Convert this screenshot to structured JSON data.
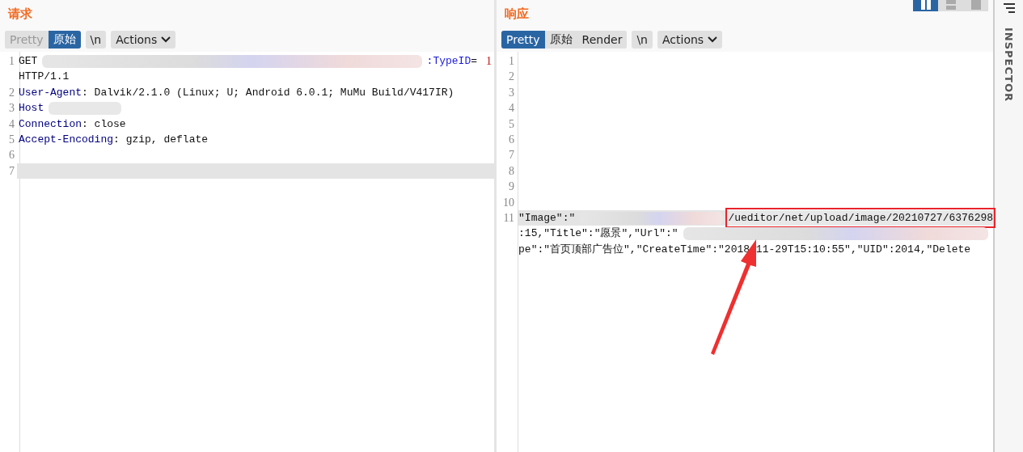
{
  "request": {
    "title": "请求",
    "tabs": [
      {
        "label": "Pretty",
        "selected": false,
        "disabled": true
      },
      {
        "label": "原始",
        "selected": true,
        "disabled": false
      }
    ],
    "buttons": [
      {
        "label": "\\n",
        "caret": false
      },
      {
        "label": "Actions",
        "caret": true
      }
    ],
    "lines": [
      {
        "number": "1",
        "highlighted": false,
        "rows": [
          [
            {
              "kind": "plain",
              "text": "GET"
            },
            {
              "kind": "blur"
            },
            {
              "kind": "param",
              "text": ":TypeID"
            },
            {
              "kind": "plain",
              "text": "="
            },
            {
              "kind": "num",
              "text": "1"
            }
          ],
          [
            {
              "kind": "plain",
              "text": "HTTP/1.1"
            }
          ]
        ]
      },
      {
        "number": "2",
        "highlighted": false,
        "rows": [
          [
            {
              "kind": "key",
              "text": "User-Agent"
            },
            {
              "kind": "plain",
              "text": ": Dalvik/2.1.0 (Linux; U; Android 6.0.1; MuMu Build/V417IR)"
            }
          ]
        ]
      },
      {
        "number": "3",
        "highlighted": false,
        "rows": [
          [
            {
              "kind": "key",
              "text": "Host"
            },
            {
              "kind": "blur-short"
            }
          ]
        ]
      },
      {
        "number": "4",
        "highlighted": false,
        "rows": [
          [
            {
              "kind": "key",
              "text": "Connection"
            },
            {
              "kind": "plain",
              "text": ": close"
            }
          ]
        ]
      },
      {
        "number": "5",
        "highlighted": false,
        "rows": [
          [
            {
              "kind": "key",
              "text": "Accept-Encoding"
            },
            {
              "kind": "plain",
              "text": ": gzip, deflate"
            }
          ]
        ]
      },
      {
        "number": "6",
        "highlighted": false,
        "rows": [
          []
        ]
      },
      {
        "number": "7",
        "highlighted": true,
        "rows": [
          []
        ]
      }
    ]
  },
  "response": {
    "title": "响应",
    "tabs": [
      {
        "label": "Pretty",
        "selected": true,
        "disabled": false
      },
      {
        "label": "原始",
        "selected": false,
        "disabled": false
      },
      {
        "label": "Render",
        "selected": false,
        "disabled": false
      }
    ],
    "buttons": [
      {
        "label": "\\n",
        "caret": false
      },
      {
        "label": "Actions",
        "caret": true
      }
    ],
    "lines": [
      {
        "number": "1",
        "highlighted": false,
        "rows": [
          []
        ]
      },
      {
        "number": "2",
        "highlighted": false,
        "rows": [
          []
        ]
      },
      {
        "number": "3",
        "highlighted": false,
        "rows": [
          []
        ]
      },
      {
        "number": "4",
        "highlighted": false,
        "rows": [
          []
        ]
      },
      {
        "number": "5",
        "highlighted": false,
        "rows": [
          []
        ]
      },
      {
        "number": "6",
        "highlighted": false,
        "rows": [
          []
        ]
      },
      {
        "number": "7",
        "highlighted": false,
        "rows": [
          []
        ]
      },
      {
        "number": "8",
        "highlighted": false,
        "rows": [
          []
        ]
      },
      {
        "number": "9",
        "highlighted": false,
        "rows": [
          []
        ]
      },
      {
        "number": "10",
        "highlighted": false,
        "rows": [
          []
        ]
      },
      {
        "number": "11",
        "highlighted": true,
        "rows": [
          [
            {
              "kind": "plain",
              "text": "\"Image\":\""
            },
            {
              "kind": "blur"
            },
            {
              "kind": "boxed",
              "text": "/ueditor/net/upload/image/20210727/6376298"
            }
          ],
          [
            {
              "kind": "plain",
              "text": ":15,\"Title\":\"愿景\",\"Url\":\""
            },
            {
              "kind": "blur"
            }
          ],
          [
            {
              "kind": "plain",
              "text": "pe\":\"首页顶部广告位\",\"CreateTime\":\"2018-11-29T15:10:55\",\"UID\":2014,\"Delete"
            }
          ]
        ]
      }
    ]
  },
  "layout_toggles": [
    {
      "selected": true
    },
    {
      "selected": false
    },
    {
      "selected": false
    }
  ],
  "inspector": {
    "label": "INSPECTOR"
  }
}
